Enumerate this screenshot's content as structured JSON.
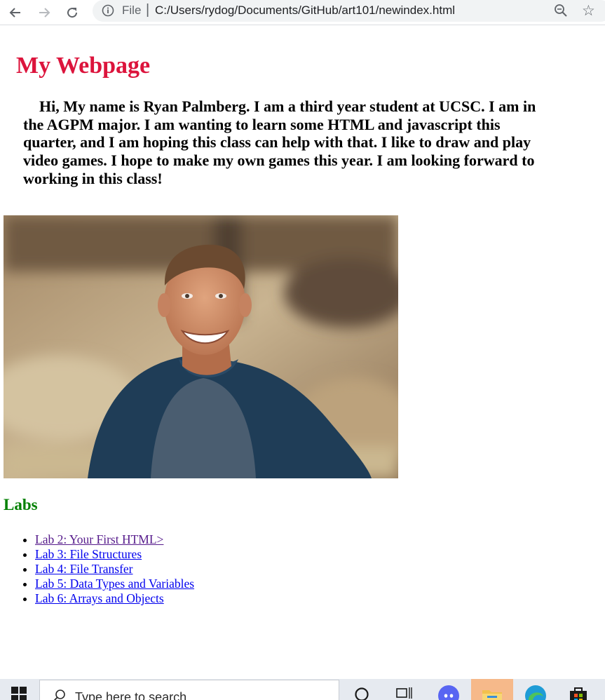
{
  "browser": {
    "protocol_label": "File",
    "separator": "|",
    "url": "C:/Users/rydog/Documents/GitHub/art101/newindex.html"
  },
  "page": {
    "title": "My Webpage",
    "intro": "Hi, My name is Ryan Palmberg. I am a third year student at UCSC. I am in the AGPM major. I am wanting to learn some HTML and javascript this quarter, and I am hoping this class can help with that. I like to draw and play video games. I hope to make my own games this year. I am looking forward to working in this class!",
    "labs_heading": "Labs",
    "labs": [
      {
        "label": "Lab 2: Your First HTML>",
        "visited": true
      },
      {
        "label": "Lab 3: File Structures",
        "visited": false
      },
      {
        "label": "Lab 4: File Transfer",
        "visited": false
      },
      {
        "label": "Lab 5: Data Types and Variables",
        "visited": false
      },
      {
        "label": "Lab 6: Arrays and Objects",
        "visited": false
      }
    ],
    "photo_icon": "portrait-photo",
    "colors": {
      "title": "#dc143c",
      "labs_heading": "#008000",
      "link": "#0000ee",
      "visited_link": "#551a8b"
    }
  },
  "taskbar": {
    "search_placeholder": "Type here to search",
    "icons": [
      "windows-start-icon",
      "search-icon",
      "cortana-icon",
      "task-view-icon",
      "discord-icon",
      "file-explorer-icon",
      "edge-icon",
      "store-icon"
    ]
  }
}
